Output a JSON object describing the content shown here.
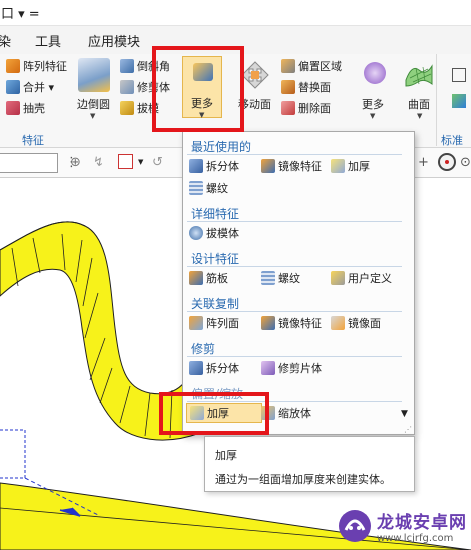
{
  "titlebar": {
    "text": "口 ▾ ="
  },
  "menubar": {
    "items": [
      "染",
      "工具",
      "应用模块"
    ]
  },
  "ribbon": {
    "feature_group_items": [
      "阵列特征",
      "合并 ▾",
      "抽壳"
    ],
    "edge_blend_label": "边倒圆",
    "draft_items": [
      "倒斜角",
      "修剪体",
      "拔模"
    ],
    "more_label": "更多",
    "move_face_label": "移动面",
    "sync_items": [
      "偏置区域",
      "替换面",
      "删除面"
    ],
    "more_label_2": "更多",
    "surface_label": "曲面",
    "group_feature": "特征",
    "group_right": "标准化"
  },
  "dropdown": {
    "sections": {
      "recent": "最近使用的",
      "detail": "详细特征",
      "design": "设计特征",
      "assoc": "关联复制",
      "trim": "修剪",
      "offset": "偏置/缩放"
    },
    "items": {
      "split_body": "拆分体",
      "mirror_feature": "镜像特征",
      "thicken": "加厚",
      "thread": "螺纹",
      "draft_body": "拔模体",
      "rib": "筋板",
      "thread2": "螺纹",
      "user_defined": "用户定义",
      "pattern_face": "阵列面",
      "mirror_feature2": "镜像特征",
      "mirror_face": "镜像面",
      "split_body2": "拆分体",
      "trim_sheet": "修剪片体",
      "thicken2": "加厚",
      "scale_body": "缩放体"
    }
  },
  "tooltip": {
    "title": "加厚",
    "description": "通过为一组面增加厚度来创建实体。"
  },
  "watermark": {
    "text": "龙城安卓网",
    "url": "www.lcjrfg.com"
  },
  "colors": {
    "accent": "#2a6ab0",
    "highlight": "#e4161b",
    "model_fill": "#f7f21a",
    "hover": "#fce4a8"
  }
}
